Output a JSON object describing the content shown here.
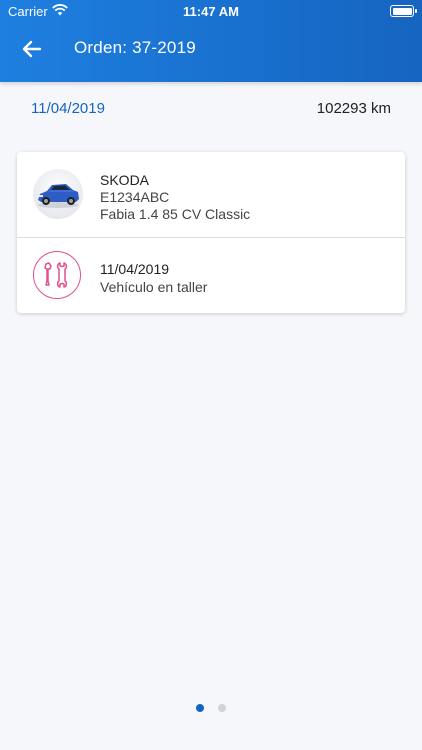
{
  "status_bar": {
    "carrier": "Carrier",
    "time": "11:47 AM"
  },
  "header": {
    "title": "Orden: 37-2019",
    "back_icon": "arrow-left"
  },
  "summary": {
    "date": "11/04/2019",
    "mileage": "102293 km"
  },
  "vehicle": {
    "brand": "SKODA",
    "plate": "E1234ABC",
    "model": "Fabia 1.4 85 CV Classic",
    "image": "car-photo"
  },
  "service": {
    "date": "11/04/2019",
    "status": "Vehículo en taller",
    "icon": "wrench-screwdriver-icon"
  },
  "pager": {
    "pages": 2,
    "current": 1
  },
  "colors": {
    "header": "#1e7fe0",
    "accent": "#1565c0",
    "service_icon": "#e24f8d",
    "background": "#f6f7fb"
  }
}
